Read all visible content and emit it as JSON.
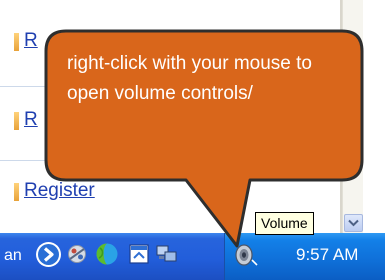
{
  "page": {
    "links": [
      {
        "label": "R"
      },
      {
        "label": "R"
      },
      {
        "label": "Register"
      }
    ]
  },
  "callout": {
    "text": "right-click with your mouse to open volume controls/",
    "fill": "#d9661b"
  },
  "tooltip": {
    "text": "Volume"
  },
  "taskbar": {
    "fragment": "an",
    "clock": "9:57 AM",
    "tray_icons": [
      "back-arrow-icon",
      "network-icon",
      "globe-icon",
      "window-icon",
      "computers-icon",
      "speaker-icon"
    ]
  },
  "colors": {
    "taskbar": "#225edb",
    "tray": "#0f6fd8",
    "link": "#1f3fb0",
    "tooltip_bg": "#ffffe1"
  }
}
